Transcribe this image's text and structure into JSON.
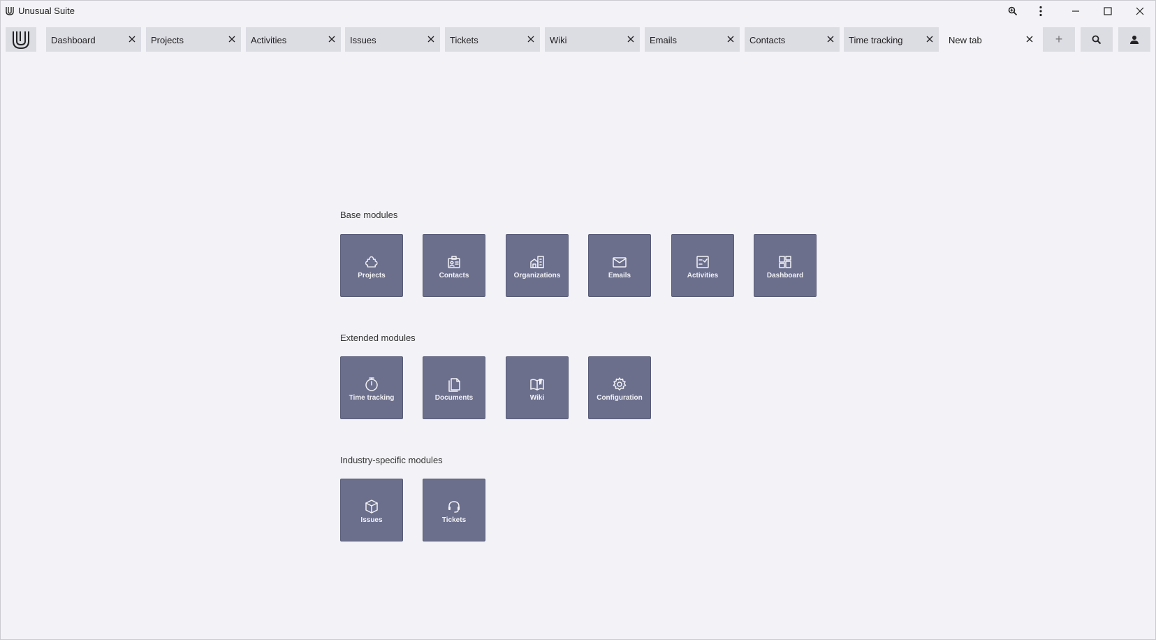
{
  "window": {
    "title": "Unusual Suite"
  },
  "titlebar_icons": [
    "zoom-icon",
    "more-vert-icon",
    "minimize-icon",
    "maximize-icon",
    "close-icon"
  ],
  "tabs": [
    {
      "label": "Dashboard",
      "active": false
    },
    {
      "label": "Projects",
      "active": false
    },
    {
      "label": "Activities",
      "active": false
    },
    {
      "label": "Issues",
      "active": false
    },
    {
      "label": "Tickets",
      "active": false
    },
    {
      "label": "Wiki",
      "active": false
    },
    {
      "label": "Emails",
      "active": false
    },
    {
      "label": "Contacts",
      "active": false
    },
    {
      "label": "Time tracking",
      "active": false
    },
    {
      "label": "New tab",
      "active": true
    }
  ],
  "strip_buttons": {
    "add": "+",
    "search_icon": "search-icon",
    "profile_icon": "person-icon"
  },
  "sections": {
    "base": {
      "title": "Base modules",
      "modules": [
        {
          "label": "Projects",
          "icon": "puzzle-icon"
        },
        {
          "label": "Contacts",
          "icon": "contact-card-icon"
        },
        {
          "label": "Organizations",
          "icon": "building-icon"
        },
        {
          "label": "Emails",
          "icon": "envelope-icon"
        },
        {
          "label": "Activities",
          "icon": "checklist-icon"
        },
        {
          "label": "Dashboard",
          "icon": "dashboard-grid-icon"
        }
      ]
    },
    "extended": {
      "title": "Extended modules",
      "modules": [
        {
          "label": "Time tracking",
          "icon": "stopwatch-icon"
        },
        {
          "label": "Documents",
          "icon": "documents-icon"
        },
        {
          "label": "Wiki",
          "icon": "book-icon"
        },
        {
          "label": "Configuration",
          "icon": "gear-icon"
        }
      ]
    },
    "industry": {
      "title": "Industry-specific modules",
      "modules": [
        {
          "label": "Issues",
          "icon": "cube-icon"
        },
        {
          "label": "Tickets",
          "icon": "headset-icon"
        }
      ]
    }
  },
  "colors": {
    "background": "#f3f3f7",
    "tab_background": "#dcdce3",
    "tile_background": "#6b6f8c",
    "tile_text": "#f2f2f6"
  }
}
